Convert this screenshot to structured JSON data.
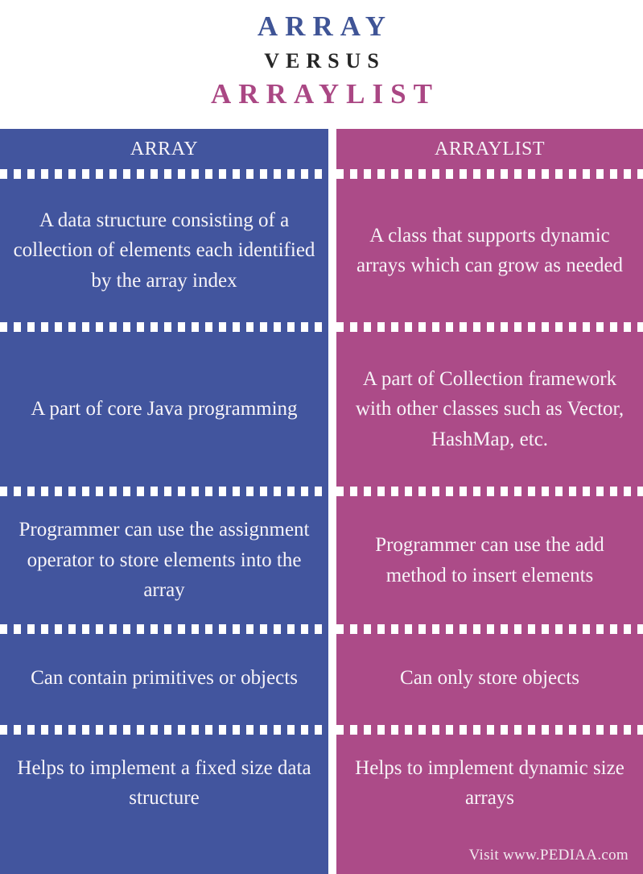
{
  "title": {
    "main": "ARRAY",
    "versus": "VERSUS",
    "sub": "ARRAYLIST"
  },
  "colors": {
    "left_column": "#42559E",
    "right_column": "#AC4B88",
    "title_main": "#3F5496",
    "title_versus": "#262626",
    "title_sub": "#AA4784",
    "separator": "#FFFFFF",
    "text": "#FFFFFF",
    "background": "#FFFFFF"
  },
  "comparison": {
    "headers": {
      "left": "ARRAY",
      "right": "ARRAYLIST"
    },
    "rows": [
      {
        "left": "A data structure consisting of a collection of elements each identified by the array index",
        "right": "A class that supports dynamic arrays which can grow as needed"
      },
      {
        "left": "A part of core Java programming",
        "right": "A part of Collection framework with other classes such as Vector, HashMap, etc."
      },
      {
        "left": "Programmer can use the assignment operator to store elements into the array",
        "right": "Programmer can use the add method to insert elements"
      },
      {
        "left": "Can contain primitives or objects",
        "right": "Can only store objects"
      },
      {
        "left": "Helps to implement a fixed size data structure",
        "right": "Helps to implement dynamic size arrays"
      }
    ]
  },
  "footer": {
    "attribution": "Visit www.PEDIAA.com"
  }
}
